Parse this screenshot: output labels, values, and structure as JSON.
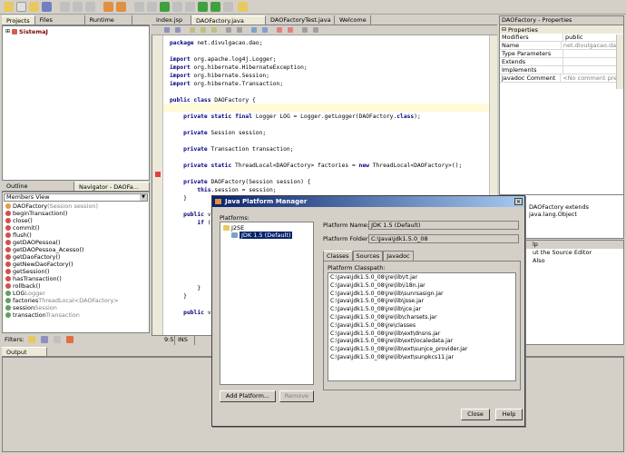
{
  "left_tabs": [
    "Projects",
    "Files",
    "Runtime"
  ],
  "project_root": "SistemaJ",
  "outline_tabs": [
    "Outline",
    "Navigator - DAOFa..."
  ],
  "members_view": "Members View",
  "members": [
    {
      "name": "DAOFactory",
      "detail": "(Session session)"
    },
    {
      "name": "beginTransaction()",
      "detail": ""
    },
    {
      "name": "close()",
      "detail": ""
    },
    {
      "name": "commit()",
      "detail": ""
    },
    {
      "name": "flush()",
      "detail": ""
    },
    {
      "name": "getDAOPessoa()",
      "detail": ""
    },
    {
      "name": "getDAOPessoa_Acesso()",
      "detail": ""
    },
    {
      "name": "getDaoFactory()",
      "detail": ""
    },
    {
      "name": "getNewDaoFactory()",
      "detail": ""
    },
    {
      "name": "getSession()",
      "detail": ""
    },
    {
      "name": "hasTransaction()",
      "detail": ""
    },
    {
      "name": "rollback()",
      "detail": ""
    },
    {
      "name": "LOG",
      "detail": " Logger"
    },
    {
      "name": "factories",
      "detail": " ThreadLocal<DAOFactory>"
    },
    {
      "name": "session",
      "detail": " Session"
    },
    {
      "name": "transaction",
      "detail": " Transaction"
    }
  ],
  "filters_label": "Filters:",
  "editor_tabs": [
    "index.jsp",
    "DAOFactory.java",
    "DAOFactoryTest.java",
    "Welcome"
  ],
  "code_lines": [
    "package net.divulgacao.dao;",
    "",
    "import org.apache.log4j.Logger;",
    "import org.hibernate.HibernateException;",
    "import org.hibernate.Session;",
    "import org.hibernate.Transaction;",
    "",
    "public class DAOFactory {",
    "",
    "    private static final Logger LOG = Logger.getLogger(DAOFactory.class);",
    "",
    "    private Session session;",
    "",
    "    private Transaction transaction;",
    "",
    "    private static ThreadLocal<DAOFactory> factories = new ThreadLocal<DAOFactory>();",
    "",
    "    private DAOFactory(Session session) {",
    "        this.session = session;",
    "    }",
    "",
    "    public vo",
    "        if (t",
    "            t",
    "",
    "",
    "",
    "",
    "",
    "",
    "        }",
    "    }",
    "",
    "    public vo"
  ],
  "cursor_pos": "9:5",
  "ins_mode": "INS",
  "props_title": "DAOFactory - Properties",
  "props_section": "Properties",
  "props": [
    {
      "k": "Modifiers",
      "v": "public"
    },
    {
      "k": "Name",
      "v": "net.divulgacao.dao..."
    },
    {
      "k": "Type Parameters",
      "v": ""
    },
    {
      "k": "Extends",
      "v": ""
    },
    {
      "k": "Implements",
      "v": ""
    },
    {
      "k": "Javadoc Comment",
      "v": "<No comment pres..."
    }
  ],
  "right_mid_text": "DAOFactory extends java.lang.Object",
  "right_help_title": "lp",
  "right_help_lines": [
    "ut the Source Editor",
    "Also"
  ],
  "output_tab": "Output",
  "dialog": {
    "title": "Java Platform Manager",
    "platforms_label": "Platforms:",
    "tree_root": "J2SE",
    "tree_child": "JDK 1.5 (Default)",
    "platform_name_label": "Platform Name:",
    "platform_name": "JDK 1.5 (Default)",
    "platform_folder_label": "Platform Folder:",
    "platform_folder": "C:\\Java\\jdk1.5.0_08",
    "tabs": [
      "Classes",
      "Sources",
      "Javadoc"
    ],
    "classpath_label": "Platform Classpath:",
    "classpath": [
      "C:\\Java\\jdk1.5.0_08\\jre\\lib\\rt.jar",
      "C:\\Java\\jdk1.5.0_08\\jre\\lib\\i18n.jar",
      "C:\\Java\\jdk1.5.0_08\\jre\\lib\\sunrsasign.jar",
      "C:\\Java\\jdk1.5.0_08\\jre\\lib\\jsse.jar",
      "C:\\Java\\jdk1.5.0_08\\jre\\lib\\jce.jar",
      "C:\\Java\\jdk1.5.0_08\\jre\\lib\\charsets.jar",
      "C:\\Java\\jdk1.5.0_08\\jre\\classes",
      "C:\\Java\\jdk1.5.0_08\\jre\\lib\\ext\\dnsns.jar",
      "C:\\Java\\jdk1.5.0_08\\jre\\lib\\ext\\localedata.jar",
      "C:\\Java\\jdk1.5.0_08\\jre\\lib\\ext\\sunjce_provider.jar",
      "C:\\Java\\jdk1.5.0_08\\jre\\lib\\ext\\sunpkcs11.jar"
    ],
    "add_platform": "Add Platform...",
    "remove": "Remove",
    "close": "Close",
    "help": "Help"
  }
}
